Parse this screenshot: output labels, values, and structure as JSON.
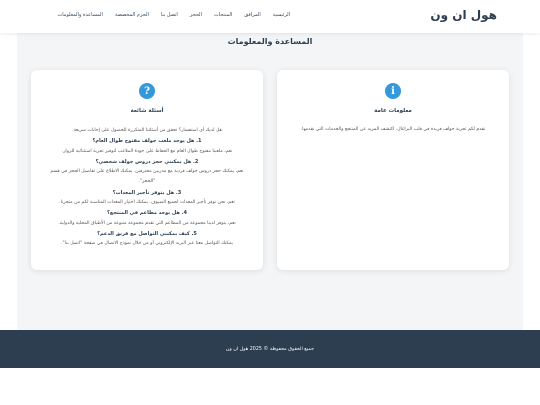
{
  "nav": {
    "brand": "هول ان ون",
    "links": [
      "الرئيسية",
      "المرافق",
      "المنتجات",
      "الحجز",
      "اتصل بنا",
      "الحزم المخصصة",
      "المساعدة والمعلومات"
    ]
  },
  "main": {
    "title": "المساعدة والمعلومات"
  },
  "general_card": {
    "icon": "info-icon",
    "icon_glyph": "i",
    "title": "معلومات عامة",
    "text": "نقدم لكم تجربة جولف فريدة في قلب البزاغال. اكتشف المزيد عن المنتجع والخدمات التي نقدمها."
  },
  "faq_card": {
    "icon": "question-icon",
    "icon_glyph": "?",
    "title": "أسئلة شائعة",
    "intro": "هل لديك أي استفسار؟ تحقق من أسئلتنا المتكررة للحصول على إجابات سريعة.",
    "items": [
      {
        "q": "1. هل يوجد ملعب جولف مفتوح طوال العام؟",
        "a": "نعم، ملعبنا مفتوح طوال العام مع الحفاظ على جودة الملاعب لتوفير تجربة استثنائية للزوار."
      },
      {
        "q": "2. هل يمكنني حجز دروس جولف شخصي؟",
        "a": "نعم، يمكنك حجز دروس جولف فردية مع مدربين محترفين. يمكنك الاطلاع على تفاصيل الحجز في قسم \"الحجز\"."
      },
      {
        "q": "3. هل يتوفر تأجير المعدات؟",
        "a": "نعم، نحن نوفر تأجير المعدات لجميع الضيوف. يمكنك اختيار المعدات المناسبة لكم من متجرنا."
      },
      {
        "q": "4. هل يوجد مطاعم في المنتجع؟",
        "a": "نعم، يتوفر لدينا مجموعة من المطاعم التي تقدم مجموعة متنوعة من الأطباق المحلية والدولية."
      },
      {
        "q": "5. كيف يمكنني التواصل مع فريق الدعم؟",
        "a": "يمكنك التواصل معنا عبر البريد الإلكتروني أو من خلال نموذج الاتصال في صفحة \"اتصل بنا\"."
      }
    ]
  },
  "footer": {
    "text": "جميع الحقوق محفوظة © 2025 هول ان ون"
  },
  "colors": {
    "accent": "#3498db",
    "footer_bg": "#2c3e50",
    "text_dark": "#2c3e50"
  }
}
